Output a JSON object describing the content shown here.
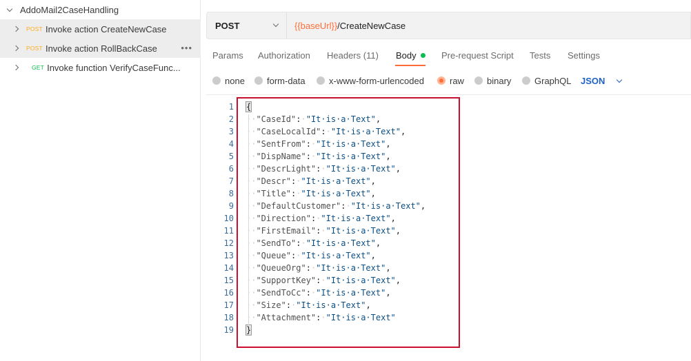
{
  "sidebar": {
    "collection": "AddoMail2CaseHandling",
    "requests": [
      {
        "method": "POST",
        "name": "Invoke action CreateNewCase",
        "more": "•••"
      },
      {
        "method": "POST",
        "name": "Invoke action RollBackCase",
        "more": "•••"
      },
      {
        "method": "GET",
        "name": "Invoke function VerifyCaseFunc..."
      }
    ]
  },
  "request": {
    "method": "POST",
    "url_variable": "{{baseUrl}}",
    "url_path": "/CreateNewCase"
  },
  "tabs": [
    "Params",
    "Authorization",
    "Headers (11)",
    "Body",
    "Pre-request Script",
    "Tests",
    "Settings"
  ],
  "body_types": [
    "none",
    "form-data",
    "x-www-form-urlencoded",
    "raw",
    "binary",
    "GraphQL"
  ],
  "body_format": "JSON",
  "editor": {
    "line_numbers": [
      "1",
      "2",
      "3",
      "4",
      "5",
      "6",
      "7",
      "8",
      "9",
      "10",
      "11",
      "12",
      "13",
      "14",
      "15",
      "16",
      "17",
      "18",
      "19"
    ],
    "open_brace": "{",
    "close_brace": "}",
    "fields": [
      {
        "key": "\"CaseId\"",
        "value": "\"It·is·a·Text\"",
        "comma": ","
      },
      {
        "key": "\"CaseLocalId\"",
        "value": "\"It·is·a·Text\"",
        "comma": ","
      },
      {
        "key": "\"SentFrom\"",
        "value": "\"It·is·a·Text\"",
        "comma": ","
      },
      {
        "key": "\"DispName\"",
        "value": "\"It·is·a·Text\"",
        "comma": ","
      },
      {
        "key": "\"DescrLight\"",
        "value": "\"It·is·a·Text\"",
        "comma": ","
      },
      {
        "key": "\"Descr\"",
        "value": "\"It·is·a·Text\"",
        "comma": ","
      },
      {
        "key": "\"Title\"",
        "value": "\"It·is·a·Text\"",
        "comma": ","
      },
      {
        "key": "\"DefaultCustomer\"",
        "value": "\"It·is·a·Text\"",
        "comma": ","
      },
      {
        "key": "\"Direction\"",
        "value": "\"It·is·a·Text\"",
        "comma": ","
      },
      {
        "key": "\"FirstEmail\"",
        "value": "\"It·is·a·Text\"",
        "comma": ","
      },
      {
        "key": "\"SendTo\"",
        "value": "\"It·is·a·Text\"",
        "comma": ","
      },
      {
        "key": "\"Queue\"",
        "value": "\"It·is·a·Text\"",
        "comma": ","
      },
      {
        "key": "\"QueueOrg\"",
        "value": "\"It·is·a·Text\"",
        "comma": ","
      },
      {
        "key": "\"SupportKey\"",
        "value": "\"It·is·a·Text\"",
        "comma": ","
      },
      {
        "key": "\"SendToCc\"",
        "value": "\"It·is·a·Text\"",
        "comma": ","
      },
      {
        "key": "\"Size\"",
        "value": "\"It·is·a·Text\"",
        "comma": ","
      },
      {
        "key": "\"Attachment\"",
        "value": "\"It·is·a·Text\"",
        "comma": ""
      }
    ]
  },
  "colors": {
    "post": "#ffad1f",
    "get": "#0cbb52",
    "accent": "#ff6c37",
    "json_blue": "#1f61c7",
    "annotation_red": "#c8102e"
  }
}
